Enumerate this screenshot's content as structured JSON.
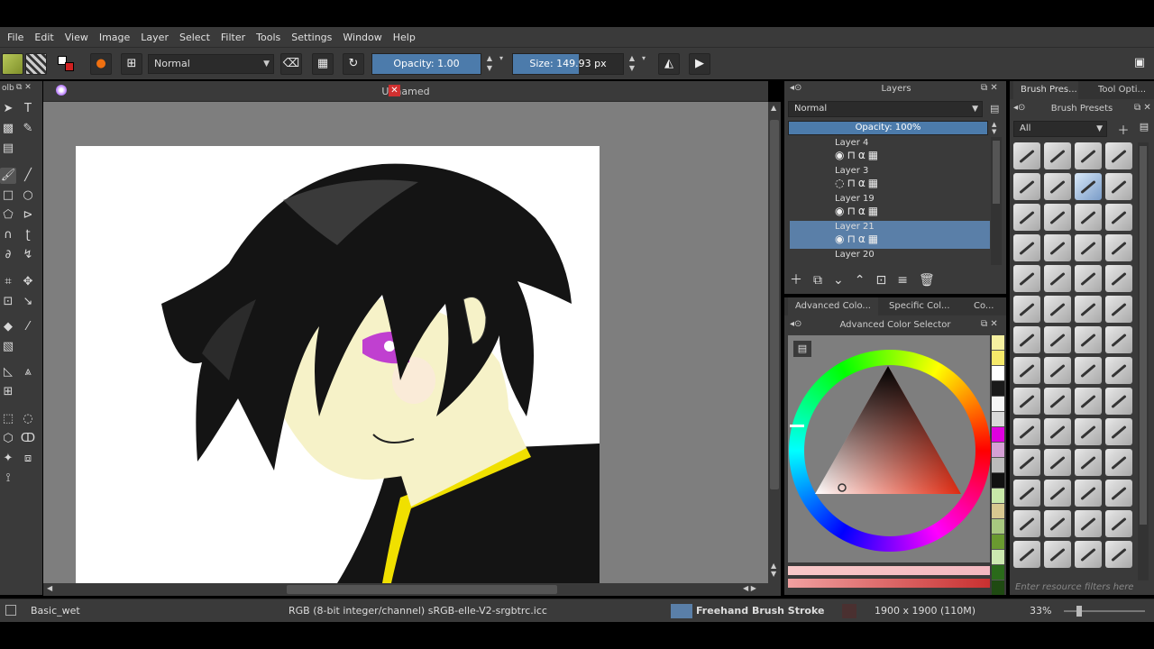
{
  "menu": [
    "File",
    "Edit",
    "View",
    "Image",
    "Layer",
    "Select",
    "Filter",
    "Tools",
    "Settings",
    "Window",
    "Help"
  ],
  "toolbar": {
    "blend_mode": "Normal",
    "opacity_label": "Opacity:  1.00",
    "opacity_value": 1.0,
    "size_label": "Size:  149.93 px",
    "size_fraction": 0.6
  },
  "document": {
    "tab_title": "Unnamed"
  },
  "toolbox": {
    "title": "olb"
  },
  "layers": {
    "title": "Layers",
    "blend_mode": "Normal",
    "opacity_label": "Opacity:  100%",
    "items": [
      {
        "name": "Layer 4"
      },
      {
        "name": "Layer 3"
      },
      {
        "name": "Layer 19"
      },
      {
        "name": "Layer 21",
        "selected": true
      },
      {
        "name": "Layer 20"
      }
    ]
  },
  "color_tabs": [
    "Advanced Colo...",
    "Specific Col...",
    "Co..."
  ],
  "color_selector_title": "Advanced Color Selector",
  "brush_tabs": [
    "Brush Pres...",
    "Tool Opti..."
  ],
  "brush_presets": {
    "title": "Brush Presets",
    "filter": "All",
    "search_placeholder": "Enter resource filters here"
  },
  "status": {
    "brush": "Basic_wet",
    "color_profile": "RGB (8-bit integer/channel)  sRGB-elle-V2-srgbtrc.icc",
    "action": "Freehand Brush Stroke",
    "dimensions": "1900 x 1900 (110M)",
    "zoom": "33%"
  },
  "colors": {
    "accent": "#4c7bab",
    "panel": "#3a3a3a",
    "canvas_bg": "#7e7e7e"
  },
  "swatches": [
    "#f5f0a0",
    "#f6e96a",
    "#ffffff",
    "#1a1a1a",
    "#f5f5f5",
    "#d8d8d8",
    "#e000e0",
    "#d5a0d5",
    "#bbbbbb",
    "#111111",
    "#c8e8a8",
    "#d8c890",
    "#a8c880",
    "#6a9a30",
    "#cce8b0",
    "#2a6a1a",
    "#1f4a12"
  ]
}
